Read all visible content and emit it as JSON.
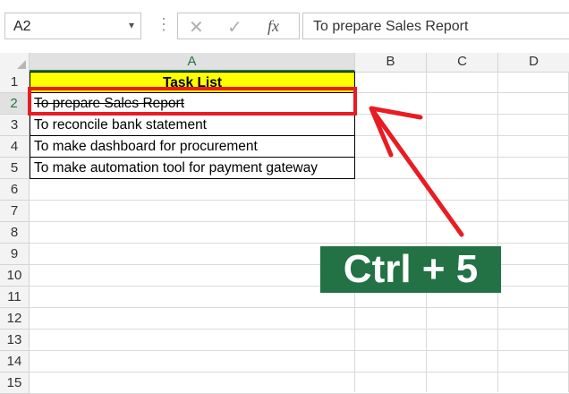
{
  "formula_bar": {
    "name_box": "A2",
    "fx_label": "fx",
    "formula_text": "To prepare Sales Report"
  },
  "columns": [
    "A",
    "B",
    "C",
    "D"
  ],
  "selected_cell": "A2",
  "rows": [
    "1",
    "2",
    "3",
    "4",
    "5",
    "6",
    "7",
    "8",
    "9",
    "10",
    "11",
    "12",
    "13",
    "14",
    "15"
  ],
  "table": {
    "header": "Task List",
    "tasks": [
      {
        "text": "To prepare Sales Report",
        "strikethrough": true
      },
      {
        "text": "To reconcile bank statement",
        "strikethrough": false
      },
      {
        "text": "To make dashboard for procurement",
        "strikethrough": false
      },
      {
        "text": "To make automation tool for payment gateway",
        "strikethrough": false
      }
    ]
  },
  "annotation": {
    "shortcut": "Ctrl + 5",
    "highlight_color": "#e81c23",
    "banner_color": "#227245"
  }
}
